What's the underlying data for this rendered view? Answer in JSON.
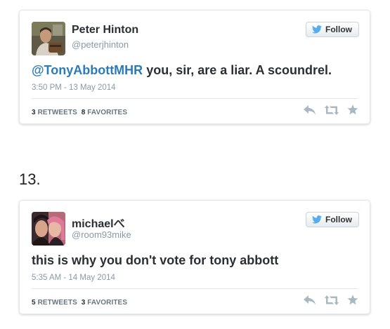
{
  "tweets": [
    {
      "name": "Peter Hinton",
      "handle": "@peterjhinton",
      "follow_label": "Follow",
      "mention": "@TonyAbbottMHR",
      "text": " you, sir, are a liar. A scoundrel.",
      "timestamp": "3:50 PM - 13 May 2014",
      "retweets_count": "3",
      "retweets_label": "RETWEETS",
      "favorites_count": "8",
      "favorites_label": "FAVORITES"
    },
    {
      "name": "michaelべ",
      "handle": "@room93mike",
      "follow_label": "Follow",
      "text": "this is why you don't vote for tony abbott",
      "timestamp": "5:35 AM - 14 May 2014",
      "retweets_count": "5",
      "retweets_label": "RETWEETS",
      "favorites_count": "3",
      "favorites_label": "FAVORITES"
    }
  ],
  "list_number": "13.",
  "icons": {
    "bird": "twitter-bird-icon",
    "reply": "reply-icon",
    "retweet": "retweet-icon",
    "favorite": "star-icon"
  },
  "colors": {
    "mention": "#2b7bb9",
    "bird": "#55acee",
    "action_icon": "#aab8c2",
    "muted": "#8899a6"
  }
}
